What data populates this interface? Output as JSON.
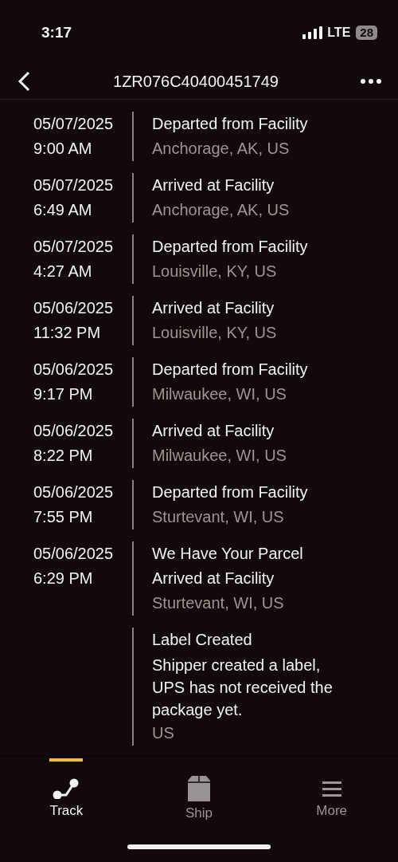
{
  "status_bar": {
    "time": "3:17",
    "network": "LTE",
    "battery": "28"
  },
  "header": {
    "title": "1ZR076C40400451749"
  },
  "events": [
    {
      "date": "05/07/2025",
      "time": "9:00 AM",
      "status": [
        "Departed from Facility"
      ],
      "location": "Anchorage, AK, US"
    },
    {
      "date": "05/07/2025",
      "time": "6:49 AM",
      "status": [
        "Arrived at Facility"
      ],
      "location": "Anchorage, AK, US"
    },
    {
      "date": "05/07/2025",
      "time": "4:27 AM",
      "status": [
        "Departed from Facility"
      ],
      "location": "Louisville, KY, US"
    },
    {
      "date": "05/06/2025",
      "time": "11:32 PM",
      "status": [
        "Arrived at Facility"
      ],
      "location": "Louisville, KY, US"
    },
    {
      "date": "05/06/2025",
      "time": "9:17 PM",
      "status": [
        "Departed from Facility"
      ],
      "location": "Milwaukee, WI, US"
    },
    {
      "date": "05/06/2025",
      "time": "8:22 PM",
      "status": [
        "Arrived at Facility"
      ],
      "location": "Milwaukee, WI, US"
    },
    {
      "date": "05/06/2025",
      "time": "7:55 PM",
      "status": [
        "Departed from Facility"
      ],
      "location": "Sturtevant, WI, US"
    },
    {
      "date": "05/06/2025",
      "time": "6:29 PM",
      "status": [
        "We Have Your Parcel",
        "Arrived at Facility"
      ],
      "location": "Sturtevant, WI, US"
    },
    {
      "status": [
        "Label Created"
      ],
      "note": "Shipper created a label, UPS has not received the package yet.",
      "location": "US"
    }
  ],
  "tabs": [
    {
      "kind": "track",
      "label": "Track",
      "selected": true
    },
    {
      "kind": "ship",
      "label": "Ship",
      "selected": false
    },
    {
      "kind": "more",
      "label": "More",
      "selected": false
    }
  ]
}
